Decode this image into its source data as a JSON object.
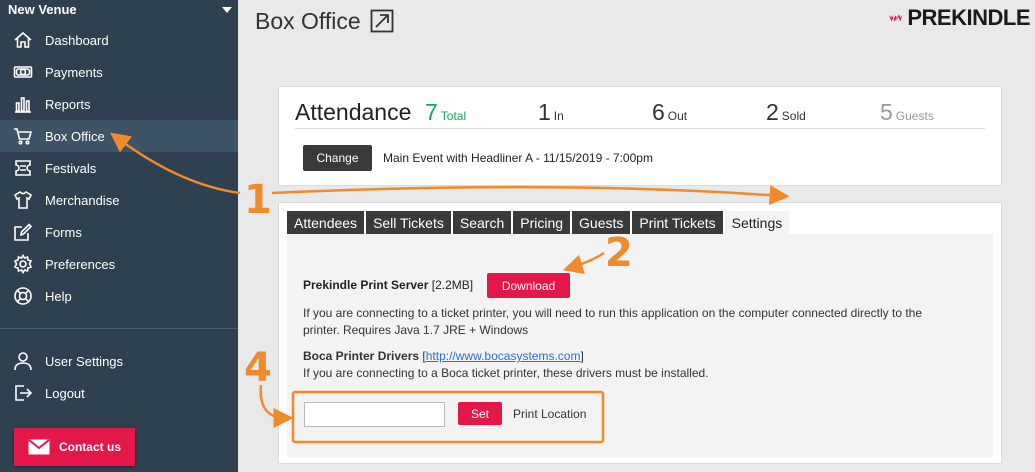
{
  "sidebar": {
    "venue": "New Venue",
    "items": [
      {
        "label": "Dashboard",
        "icon": "home-icon"
      },
      {
        "label": "Payments",
        "icon": "money-icon"
      },
      {
        "label": "Reports",
        "icon": "bar-chart-icon"
      },
      {
        "label": "Box Office",
        "icon": "cart-icon",
        "active": true
      },
      {
        "label": "Festivals",
        "icon": "ticket-icon"
      },
      {
        "label": "Merchandise",
        "icon": "shirt-icon"
      },
      {
        "label": "Forms",
        "icon": "edit-icon"
      },
      {
        "label": "Preferences",
        "icon": "gear-icon"
      },
      {
        "label": "Help",
        "icon": "help-icon"
      }
    ],
    "bottom_items": [
      {
        "label": "User Settings",
        "icon": "user-icon"
      },
      {
        "label": "Logout",
        "icon": "logout-icon"
      }
    ],
    "contact_label": "Contact us"
  },
  "header": {
    "title": "Box Office",
    "logo_text": "PREKINDLE"
  },
  "attendance": {
    "title": "Attendance",
    "stats": [
      {
        "value": "7",
        "label": "Total"
      },
      {
        "value": "1",
        "label": "In"
      },
      {
        "value": "6",
        "label": "Out"
      },
      {
        "value": "2",
        "label": "Sold"
      },
      {
        "value": "5",
        "label": "Guests"
      }
    ],
    "change_label": "Change",
    "event": "Main Event with Headliner A - 11/15/2019 - 7:00pm"
  },
  "tabs": [
    "Attendees",
    "Sell Tickets",
    "Search",
    "Pricing",
    "Guests",
    "Print Tickets",
    "Settings"
  ],
  "settings": {
    "print_server_label": "Prekindle Print Server",
    "print_server_size": "[2.2MB]",
    "download_label": "Download",
    "print_server_desc_1": "If you are connecting to a ticket printer, you will need to run this application on the computer connected directly to the",
    "print_server_desc_2": "printer. Requires Java 1.7 JRE + Windows",
    "boca_label": "Boca Printer Drivers",
    "boca_link": "http://www.bocasystems.com",
    "boca_desc": "If you are connecting to a Boca ticket printer, these drivers must be installed.",
    "location_value": "",
    "set_label": "Set",
    "location_label": "Print Location"
  },
  "annotations": [
    "1",
    "2",
    "4"
  ],
  "colors": {
    "sidebar_bg": "#2f4050",
    "accent_red": "#e3174a",
    "annotation_orange": "#f08a2a",
    "total_green": "#1aa35a"
  }
}
